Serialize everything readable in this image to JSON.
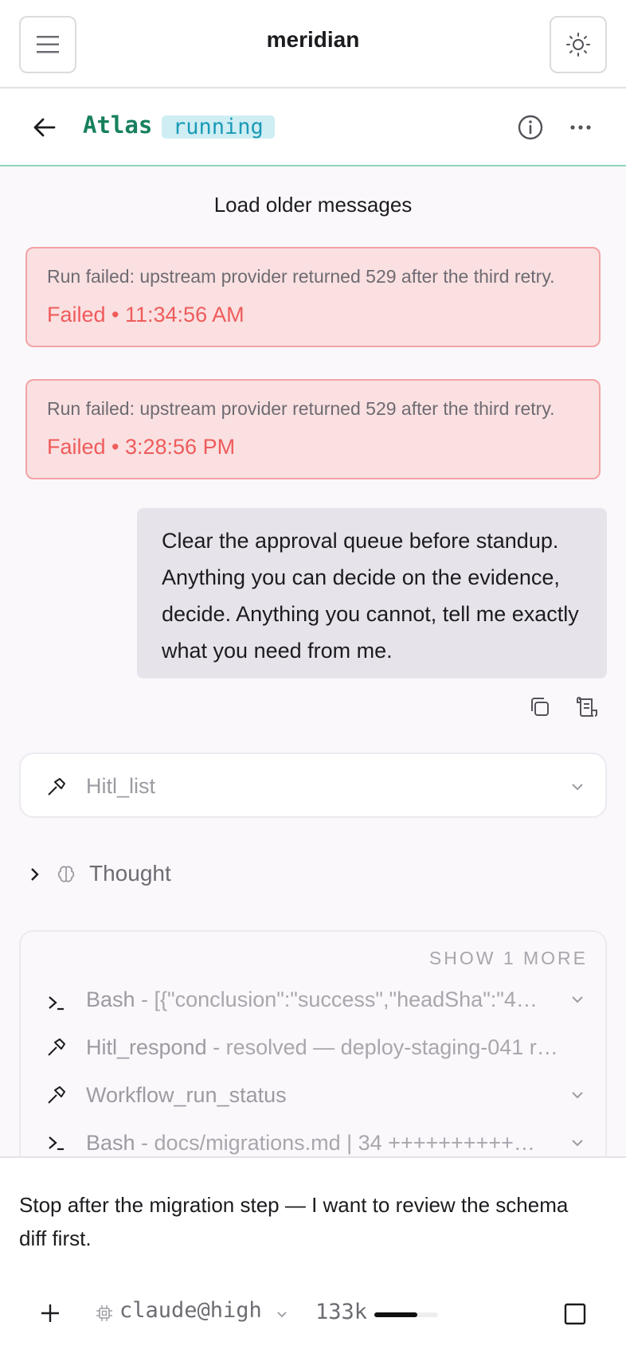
{
  "app": {
    "title": "meridian"
  },
  "agent": {
    "name": "Atlas",
    "status": "running"
  },
  "thread": {
    "load_older_label": "Load older messages",
    "errors": [
      {
        "message": "Run failed: upstream provider returned 529 after the third retry.",
        "meta": "Failed • 11:34:56 AM"
      },
      {
        "message": "Run failed: upstream provider returned 529 after the third retry.",
        "meta": "Failed • 3:28:56 PM"
      }
    ],
    "user_message": "Clear the approval queue before standup. Anything you can decide on the evidence, decide. Anything you cannot, tell me exactly what you need from me.",
    "tool_single": {
      "name": "Hitl_list"
    },
    "thought_label": "Thought",
    "tool_group": {
      "show_more_label": "SHOW 1 MORE",
      "items": [
        {
          "name": "Bash",
          "detail": " - [{\"conclusion\":\"success\",\"headSha\":\"4…",
          "icon": "terminal-icon"
        },
        {
          "name": "Hitl_respond",
          "detail": " - resolved — deploy-staging-041 r…",
          "icon": "hammer-icon"
        },
        {
          "name": "Workflow_run_status",
          "detail": "",
          "icon": "hammer-icon"
        },
        {
          "name": "Bash",
          "detail": " - docs/migrations.md | 34 ++++++++++…",
          "icon": "terminal-icon"
        }
      ]
    }
  },
  "composer": {
    "draft": "Stop after the migration step — I want to review the schema diff first.",
    "model": "claude@high",
    "tokens": "133k",
    "token_usage_fraction": 0.67
  }
}
